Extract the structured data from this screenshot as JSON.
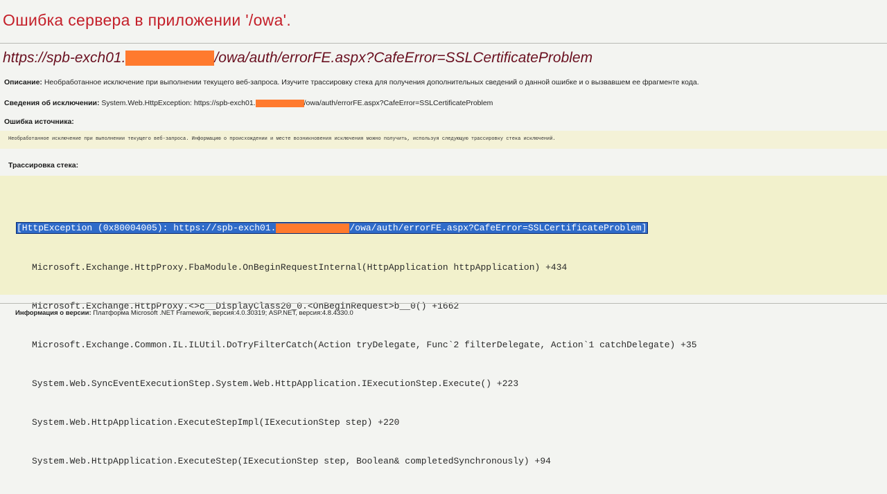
{
  "page": {
    "title": "Ошибка сервера в приложении '/owa'.",
    "url_prefix": "https://spb-exch01.",
    "url_suffix": "/owa/auth/errorFE.aspx?CafeError=SSLCertificateProblem"
  },
  "description": {
    "label": "Описание:",
    "text": "Необработанное исключение при выполнении текущего веб-запроса. Изучите трассировку стека для получения дополнительных сведений о данной ошибке и о вызвавшем ее фрагменте кода."
  },
  "exception_details": {
    "label": "Сведения об исключении:",
    "text_prefix": "System.Web.HttpException: https://spb-exch01.",
    "text_suffix": "/owa/auth/errorFE.aspx?CafeError=SSLCertificateProblem"
  },
  "source_error": {
    "label": "Ошибка источника:",
    "text": "Необработанное исключение при выполнении текущего веб-запроса. Информацию о происхождении и месте возникновения исключения можно получить, используя следующую трассировку стека исключений."
  },
  "stack_trace": {
    "label": "Трассировка стека:",
    "first_line_prefix": "[HttpException (0x80004005): https://spb-exch01.",
    "first_line_suffix": "/owa/auth/errorFE.aspx?CafeError=SSLCertificateProblem]",
    "lines": [
      "Microsoft.Exchange.HttpProxy.FbaModule.OnBeginRequestInternal(HttpApplication httpApplication) +434",
      "Microsoft.Exchange.HttpProxy.<>c__DisplayClass20_0.<OnBeginRequest>b__0() +1662",
      "Microsoft.Exchange.Common.IL.ILUtil.DoTryFilterCatch(Action tryDelegate, Func`2 filterDelegate, Action`1 catchDelegate) +35",
      "System.Web.SyncEventExecutionStep.System.Web.HttpApplication.IExecutionStep.Execute() +223",
      "System.Web.HttpApplication.ExecuteStepImpl(IExecutionStep step) +220",
      "System.Web.HttpApplication.ExecuteStep(IExecutionStep step, Boolean& completedSynchronously) +94"
    ]
  },
  "version": {
    "label": "Информация о версии:",
    "text": "Платформа Microsoft .NET Framework, версия:4.0.30319; ASP.NET, версия:4.8.4330.0"
  },
  "colors": {
    "title": "#c4202a",
    "heading": "#6a1020",
    "redaction": "#ff7a2e",
    "code_background": "#f2f1cc",
    "selection": "#2f6bc9"
  }
}
